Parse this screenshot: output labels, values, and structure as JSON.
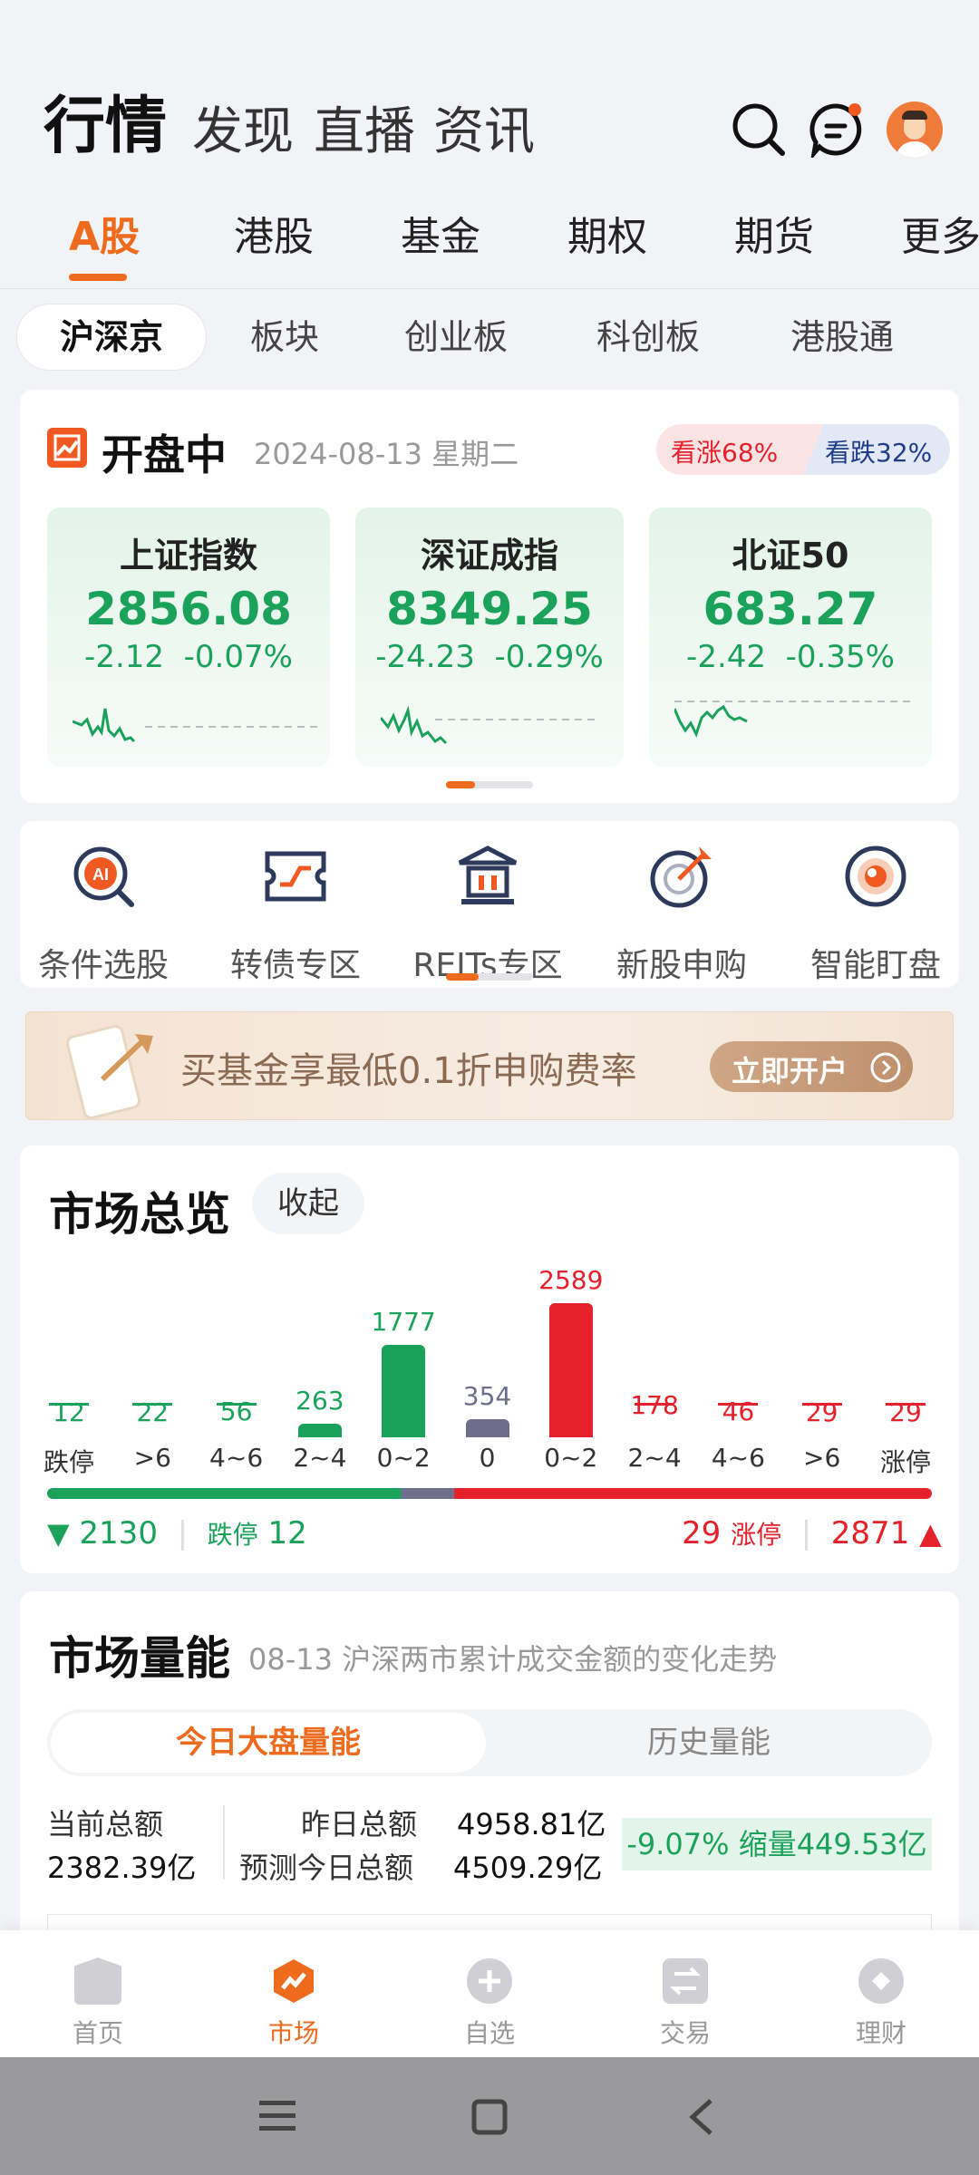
{
  "header": {
    "tabs": [
      "行情",
      "发现",
      "直播",
      "资讯"
    ]
  },
  "market_tabs": [
    "A股",
    "港股",
    "基金",
    "期权",
    "期货",
    "更多"
  ],
  "sub_tabs": [
    "沪深京",
    "板块",
    "创业板",
    "科创板",
    "港股通"
  ],
  "status": {
    "label": "开盘中",
    "date": "2024-08-13 星期二",
    "up_ratio": "看涨68%",
    "down_ratio": "看跌32%"
  },
  "indices": [
    {
      "name": "上证指数",
      "value": "2856.08",
      "change": "-2.12",
      "pct": "-0.07%"
    },
    {
      "name": "深证成指",
      "value": "8349.25",
      "change": "-24.23",
      "pct": "-0.29%"
    },
    {
      "name": "北证50",
      "value": "683.27",
      "change": "-2.42",
      "pct": "-0.35%"
    }
  ],
  "tools": [
    "条件选股",
    "转债专区",
    "REITs专区",
    "新股申购",
    "智能盯盘"
  ],
  "banner": {
    "text": "买基金享最低0.1折申购费率",
    "button": "立即开户"
  },
  "overview": {
    "title": "市场总览",
    "collapse": "收起",
    "buckets": [
      {
        "label": "跌停",
        "count": "12",
        "color": "#1aa25a"
      },
      {
        "label": ">6",
        "count": "22",
        "color": "#1aa25a"
      },
      {
        "label": "4~6",
        "count": "56",
        "color": "#1aa25a"
      },
      {
        "label": "2~4",
        "count": "263",
        "color": "#1aa25a"
      },
      {
        "label": "0~2",
        "count": "1777",
        "color": "#1aa25a"
      },
      {
        "label": "0",
        "count": "354",
        "color": "#6e6e8a"
      },
      {
        "label": "0~2",
        "count": "2589",
        "color": "#e5212c"
      },
      {
        "label": "2~4",
        "count": "178",
        "color": "#e5212c"
      },
      {
        "label": "4~6",
        "count": "46",
        "color": "#e5212c"
      },
      {
        "label": ">6",
        "count": "29",
        "color": "#e5212c"
      },
      {
        "label": "涨停",
        "count": "29",
        "color": "#e5212c"
      }
    ],
    "down_total": "2130",
    "limit_down_label": "跌停",
    "limit_down": "12",
    "limit_up": "29",
    "limit_up_label": "涨停",
    "up_total": "2871"
  },
  "volume": {
    "title": "市场量能",
    "subtitle": "08-13 沪深两市累计成交金额的变化走势",
    "tab_today": "今日大盘量能",
    "tab_history": "历史量能",
    "current_label": "当前总额",
    "current_value": "2382.39亿",
    "yesterday_label": "昨日总额",
    "yesterday_value": "4958.81亿",
    "forecast_label": "预测今日总额",
    "forecast_value": "4509.29亿",
    "change": "-9.07% 缩量449.53亿"
  },
  "bottom_nav": [
    "首页",
    "市场",
    "自选",
    "交易",
    "理财"
  ]
}
